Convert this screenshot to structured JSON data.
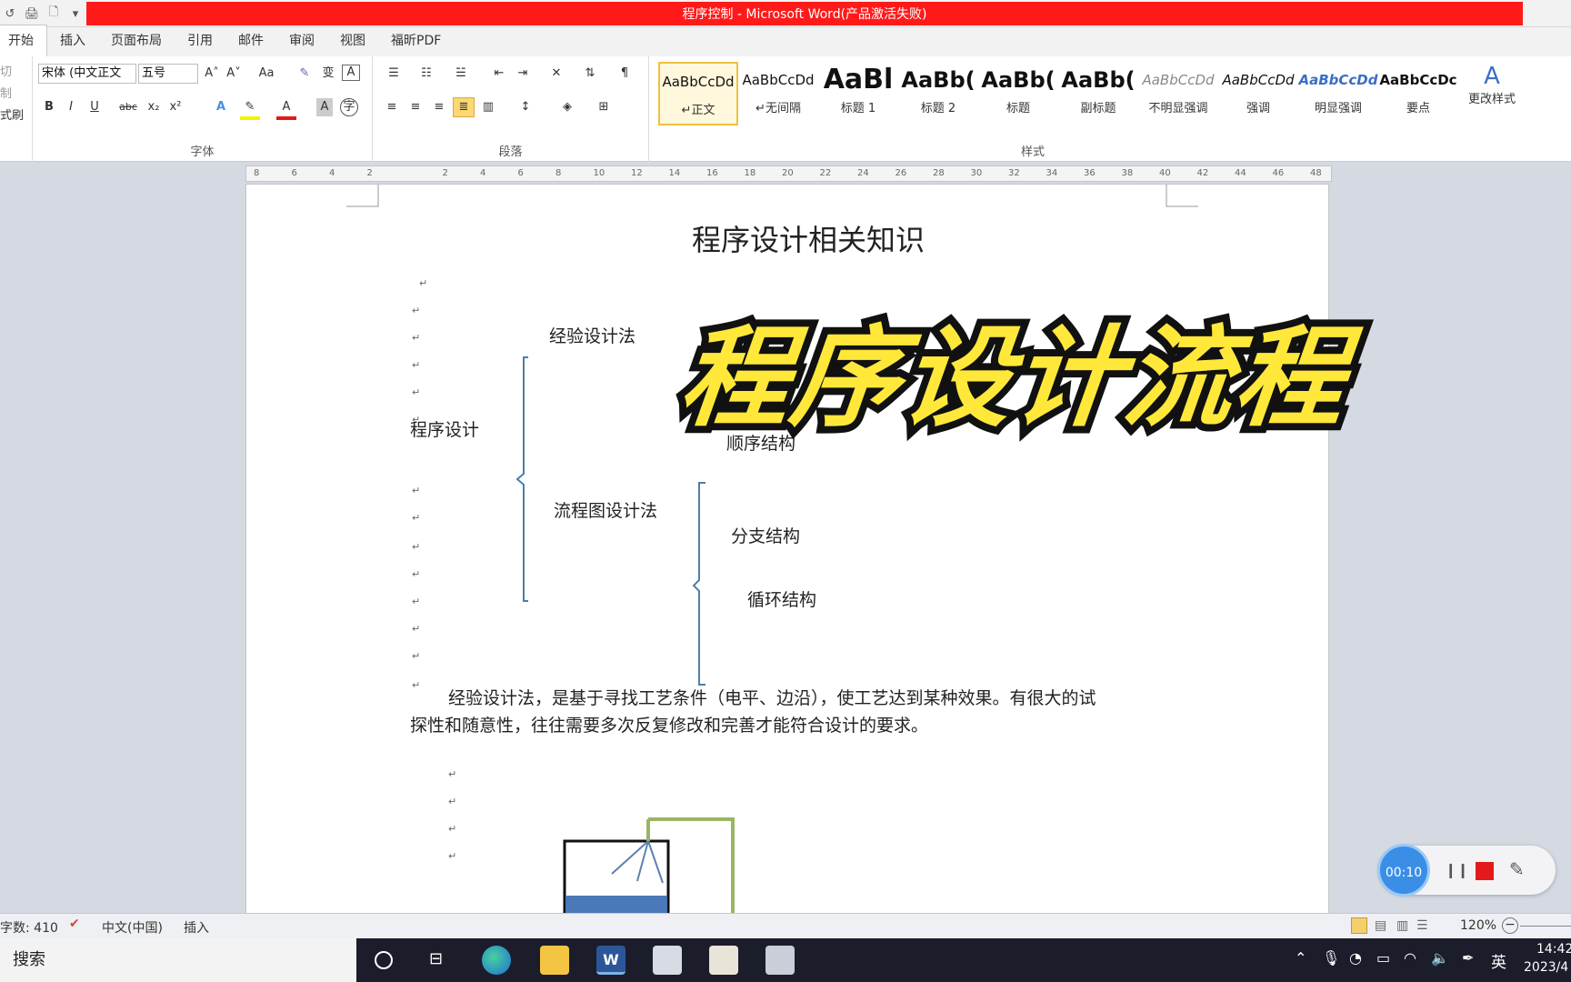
{
  "window": {
    "title": "程序控制 - Microsoft Word(产品激活失败)"
  },
  "quick_access": [
    "↺",
    "🖨",
    "🗋",
    "▾"
  ],
  "tabs": [
    "开始",
    "插入",
    "页面布局",
    "引用",
    "邮件",
    "审阅",
    "视图",
    "福昕PDF"
  ],
  "clipboard": {
    "cut": "切",
    "copy": "制",
    "painter": "式刷"
  },
  "font": {
    "name": "宋体 (中文正文",
    "size": "五号",
    "group_label": "字体",
    "grow": "A˄",
    "shrink": "A˅",
    "case": "Aa",
    "clear": "✎",
    "phonetic": "变",
    "border": "A",
    "bold": "B",
    "italic": "I",
    "underline": "U",
    "strike": "abc",
    "sub": "x₂",
    "sup": "x²"
  },
  "paragraph": {
    "group_label": "段落"
  },
  "styles": {
    "group_label": "样式",
    "change_styles": "更改样式",
    "items": [
      {
        "sample": "AaBbCcDd",
        "name": "↵正文"
      },
      {
        "sample": "AaBbCcDd",
        "name": "↵无间隔"
      },
      {
        "sample": "AaBl",
        "name": "标题 1"
      },
      {
        "sample": "AaBb(",
        "name": "标题 2"
      },
      {
        "sample": "AaBb(",
        "name": "标题"
      },
      {
        "sample": "AaBb(",
        "name": "副标题"
      },
      {
        "sample": "AaBbCcDd",
        "name": "不明显强调"
      },
      {
        "sample": "AaBbCcDd",
        "name": "强调"
      },
      {
        "sample": "AaBbCcDd",
        "name": "明显强调"
      },
      {
        "sample": "AaBbCcDc",
        "name": "要点"
      }
    ]
  },
  "ruler": {
    "ticks": [
      "8",
      "6",
      "4",
      "2",
      "",
      "2",
      "4",
      "6",
      "8",
      "10",
      "12",
      "14",
      "16",
      "18",
      "20",
      "22",
      "24",
      "26",
      "28",
      "30",
      "32",
      "34",
      "36",
      "38",
      "40",
      "42",
      "44",
      "46",
      "48"
    ]
  },
  "document": {
    "title": "程序设计相关知识",
    "overlay": "程序设计流程",
    "root": "程序设计",
    "branch1": "经验设计法",
    "branch2": "流程图设计法",
    "sub1": "顺序结构",
    "sub2": "分支结构",
    "sub3": "循环结构",
    "para_line1": "经验设计法，是基于寻找工艺条件（电平、边沿），使工艺达到某种效果。有很大的试",
    "para_line2": "探性和随意性，往往需要多次反复修改和完善才能符合设计的要求。",
    "mark": "↵"
  },
  "status": {
    "words": "字数: 410",
    "lang": "中文(中国)",
    "mode": "插入",
    "zoom": "120%"
  },
  "taskbar": {
    "search": "搜索",
    "ime": "英",
    "time": "14:42",
    "date": "2023/4"
  },
  "recorder": {
    "time": "00:10"
  },
  "colors": {
    "title_red": "#ff1a1a",
    "brace": "#4f7fa8",
    "overlay_fill": "#ffe83a",
    "taskbar": "#1b1d2b",
    "rec_blue": "#3a8ee6"
  }
}
